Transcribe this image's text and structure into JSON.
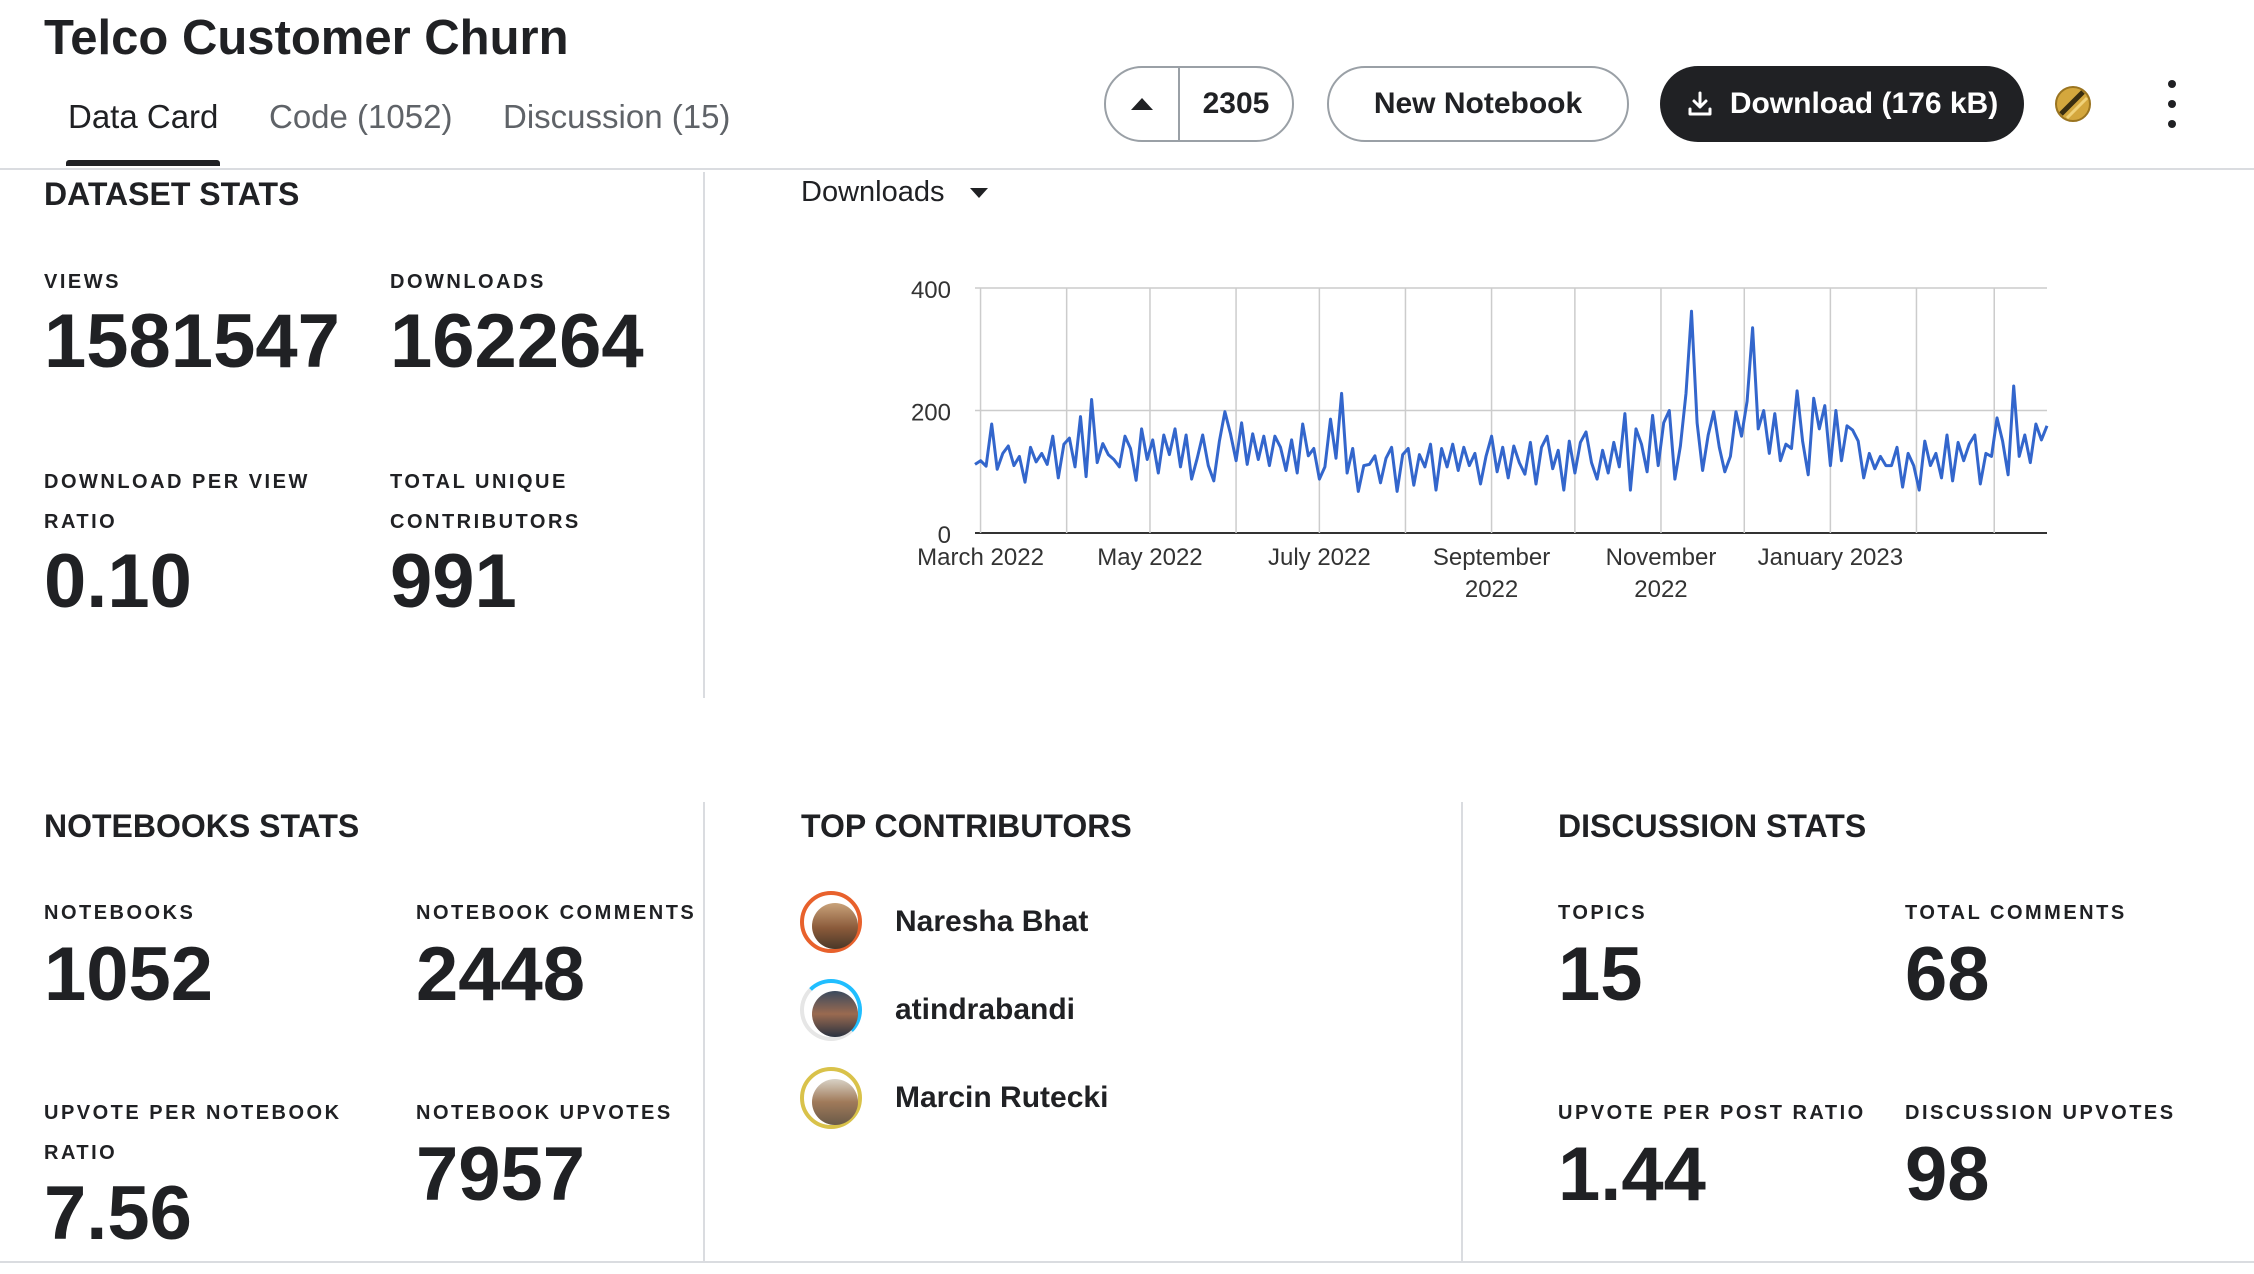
{
  "header": {
    "title": "Telco Customer Churn",
    "tabs": [
      {
        "label": "Data Card",
        "active": true
      },
      {
        "label": "Code (1052)",
        "active": false
      },
      {
        "label": "Discussion (15)",
        "active": false
      }
    ],
    "vote_count": "2305",
    "new_notebook_label": "New Notebook",
    "download_label": "Download (176 kB)"
  },
  "dataset_stats": {
    "title": "DATASET STATS",
    "views_label": "VIEWS",
    "views": "1581547",
    "downloads_label": "DOWNLOADS",
    "downloads": "162264",
    "ratio_label_1": "DOWNLOAD PER VIEW",
    "ratio_label_2": "RATIO",
    "ratio": "0.10",
    "contributors_label_1": "TOTAL UNIQUE",
    "contributors_label_2": "CONTRIBUTORS",
    "contributors": "991"
  },
  "chart_metric_selector": "Downloads",
  "chart_data": {
    "type": "line",
    "title": "",
    "xlabel": "",
    "ylabel": "",
    "ylim": [
      0,
      400
    ],
    "yticks": [
      "0",
      "200",
      "400"
    ],
    "xticks": [
      {
        "date": "2022-03-01",
        "lines": [
          "March 2022"
        ]
      },
      {
        "date": "2022-05-01",
        "lines": [
          "May 2022"
        ]
      },
      {
        "date": "2022-07-01",
        "lines": [
          "July 2022"
        ]
      },
      {
        "date": "2022-09-01",
        "lines": [
          "September",
          "2022"
        ]
      },
      {
        "date": "2022-11-01",
        "lines": [
          "November",
          "2022"
        ]
      },
      {
        "date": "2023-01-01",
        "lines": [
          "January 2023"
        ]
      }
    ],
    "grid": true,
    "color": "#3366cc",
    "x_start": "2022-02-27",
    "x_step": "weekly samples (approx)",
    "series": [
      {
        "values": [
          112,
          118,
          109,
          178,
          104,
          130,
          142,
          110,
          125,
          83,
          140,
          116,
          130,
          112,
          158,
          90,
          145,
          155,
          108,
          190,
          92,
          218,
          115,
          146,
          128,
          120,
          108,
          158,
          138,
          86,
          170,
          120,
          152,
          98,
          160,
          128,
          170,
          108,
          160,
          88,
          122,
          160,
          110,
          85,
          150,
          198,
          162,
          118,
          180,
          112,
          162,
          120,
          158,
          110,
          158,
          140,
          102,
          152,
          98,
          178,
          126,
          138,
          88,
          108,
          186,
          122,
          228,
          98,
          138,
          68,
          110,
          112,
          126,
          82,
          122,
          140,
          68,
          128,
          138,
          78,
          128,
          108,
          145,
          70,
          138,
          108,
          145,
          102,
          140,
          110,
          130,
          80,
          125,
          158,
          100,
          140,
          90,
          142,
          115,
          96,
          148,
          80,
          140,
          158,
          105,
          135,
          70,
          150,
          98,
          148,
          165,
          115,
          88,
          135,
          98,
          148,
          108,
          195,
          70,
          170,
          145,
          100,
          192,
          110,
          180,
          200,
          88,
          142,
          228,
          362,
          180,
          102,
          160,
          198,
          140,
          100,
          125,
          198,
          158,
          215,
          335,
          170,
          200,
          130,
          195,
          118,
          145,
          138,
          232,
          150,
          95,
          220,
          170,
          208,
          110,
          200,
          118,
          175,
          168,
          150,
          90,
          130,
          105,
          125,
          110,
          110,
          140,
          75,
          130,
          110,
          70,
          150,
          110,
          130,
          90,
          160,
          85,
          148,
          118,
          145,
          160,
          80,
          130,
          125,
          188,
          150,
          95,
          240,
          125,
          160,
          115,
          178,
          152,
          175
        ]
      }
    ]
  },
  "notebooks_stats": {
    "title": "NOTEBOOKS STATS",
    "notebooks_label": "NOTEBOOKS",
    "notebooks": "1052",
    "comments_label": "NOTEBOOK COMMENTS",
    "comments": "2448",
    "upvote_ratio_label_1": "UPVOTE PER NOTEBOOK",
    "upvote_ratio_label_2": "RATIO",
    "upvote_ratio": "7.56",
    "upvotes_label": "NOTEBOOK UPVOTES",
    "upvotes": "7957"
  },
  "top_contributors": {
    "title": "TOP CONTRIBUTORS",
    "items": [
      {
        "name": "Naresha Bhat",
        "ring": "#e8612c"
      },
      {
        "name": "atindrabandi",
        "ring": "#20beff"
      },
      {
        "name": "Marcin Rutecki",
        "ring": "#d9c24a"
      }
    ]
  },
  "discussion_stats": {
    "title": "DISCUSSION STATS",
    "topics_label": "TOPICS",
    "topics": "15",
    "comments_label": "TOTAL COMMENTS",
    "comments": "68",
    "ratio_label": "UPVOTE PER POST RATIO",
    "ratio": "1.44",
    "upvotes_label": "DISCUSSION UPVOTES",
    "upvotes": "98"
  }
}
